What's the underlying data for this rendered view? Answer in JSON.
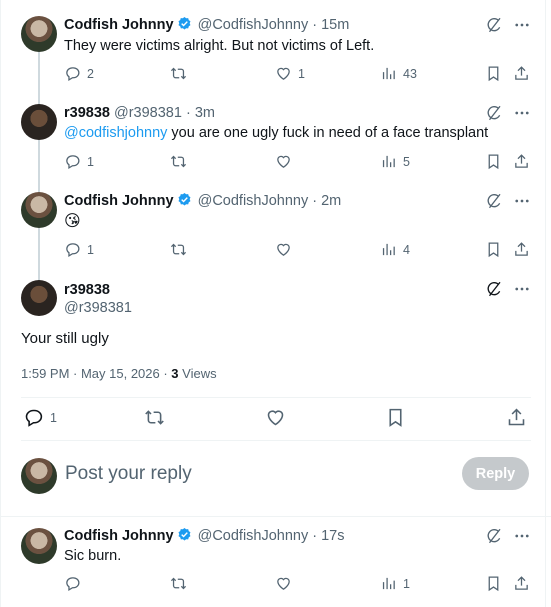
{
  "tweets": [
    {
      "name": "Codfish Johnny",
      "handle": "@CodfishJohnny",
      "time": "· 15m",
      "text": "They were victims alright. But not victims of Left.",
      "replies": "2",
      "retweets": "",
      "likes": "1",
      "views": "43"
    },
    {
      "name": "r39838",
      "handle": "@r398381",
      "time": "· 3m",
      "mention": "@codfishjohnny",
      "text": " you are one ugly fuck in need of a face transplant",
      "replies": "1",
      "retweets": "",
      "likes": "",
      "views": "5"
    },
    {
      "name": "Codfish Johnny",
      "handle": "@CodfishJohnny",
      "time": "· 2m",
      "text": "😘",
      "replies": "1",
      "retweets": "",
      "likes": "",
      "views": "4"
    }
  ],
  "focus": {
    "name": "r39838",
    "handle": "@r398381",
    "text": "Your still ugly",
    "timestamp": "1:59 PM · May 15, 2026 · ",
    "views_count": "3",
    "views_label": " Views",
    "replies": "1"
  },
  "reply_box": {
    "placeholder": "Post your reply",
    "button": "Reply"
  },
  "last": {
    "name": "Codfish Johnny",
    "handle": "@CodfishJohnny",
    "time": "· 17s",
    "text": "Sic burn.",
    "replies": "",
    "retweets": "",
    "likes": "",
    "views": "1"
  },
  "colors": {
    "accent": "#1d9bf0",
    "muted": "#536471",
    "verified": "#1d9bf0",
    "reply_disabled": "#c5c9cc"
  },
  "icons": [
    "verified-badge-icon",
    "grok-icon",
    "more-icon",
    "reply-icon",
    "retweet-icon",
    "like-icon",
    "views-icon",
    "bookmark-icon",
    "share-icon"
  ]
}
